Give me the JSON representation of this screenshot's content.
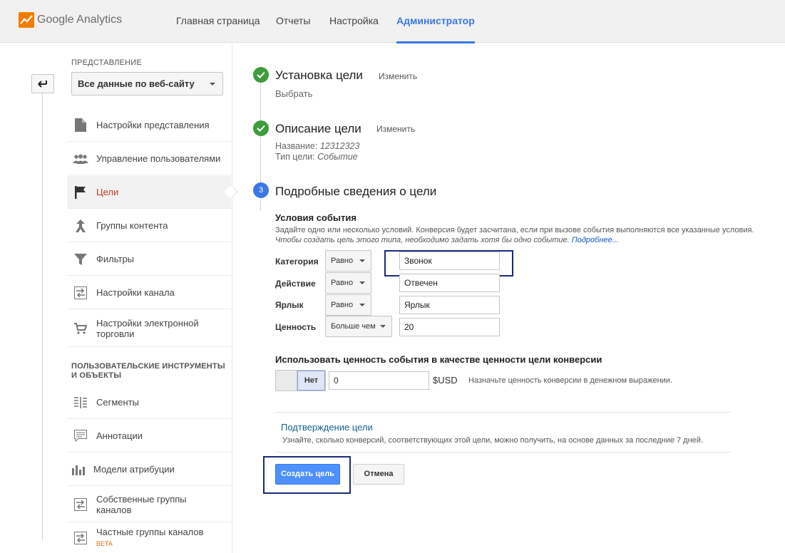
{
  "app": {
    "name": "Google Analytics",
    "accent": "#3b78e7"
  },
  "nav": {
    "items": [
      {
        "label": "Главная страница"
      },
      {
        "label": "Отчеты"
      },
      {
        "label": "Настройка"
      },
      {
        "label": "Администратор",
        "active": true
      }
    ]
  },
  "sidebar": {
    "section_view": "ПРЕДСТАВЛЕНИЕ",
    "view_select": "Все данные по веб-сайту",
    "items": [
      {
        "label": "Настройки представления",
        "icon": "document-icon"
      },
      {
        "label": "Управление пользователями",
        "icon": "users-icon"
      },
      {
        "label": "Цели",
        "icon": "flag-icon",
        "active": true
      },
      {
        "label": "Группы контента",
        "icon": "content-groups-icon"
      },
      {
        "label": "Фильтры",
        "icon": "filter-icon"
      },
      {
        "label": "Настройки канала",
        "icon": "channel-icon"
      },
      {
        "label": "Настройки электронной торговли",
        "icon": "cart-icon"
      }
    ],
    "section_custom": "ПОЛЬЗОВАТЕЛЬСКИЕ ИНСТРУМЕНТЫ И ОБЪЕКТЫ",
    "custom_items": [
      {
        "label": "Сегменты",
        "icon": "segments-icon"
      },
      {
        "label": "Аннотации",
        "icon": "annotations-icon"
      },
      {
        "label": "Модели атрибуции",
        "icon": "attribution-icon"
      },
      {
        "label": "Собственные группы каналов",
        "icon": "channel-groups-icon"
      },
      {
        "label": "Частные группы каналов",
        "badge": "BETA",
        "icon": "private-channel-groups-icon"
      }
    ]
  },
  "steps": {
    "setup": {
      "title": "Установка цели",
      "edit": "Изменить",
      "value": "Выбрать"
    },
    "description": {
      "title": "Описание цели",
      "edit": "Изменить",
      "name_label": "Название:",
      "name_value": "12312323",
      "type_label": "Тип цели:",
      "type_value": "Событие"
    },
    "details": {
      "number": "3",
      "title": "Подробные сведения о цели"
    }
  },
  "conditions": {
    "title": "Условия события",
    "desc_line1": "Задайте одно или несколько условий. Конверсия будет засчитана, если при вызове события выполняются все указанные условия.",
    "desc_line2": "Чтобы создать цель этого типа, необходимо задать хотя бы одно событие.",
    "desc_link": "Подробнее...",
    "rows": [
      {
        "label": "Категория",
        "operator": "Равно",
        "value": "Звонок"
      },
      {
        "label": "Действие",
        "operator": "Равно",
        "value": "Отвечен"
      },
      {
        "label": "Ярлык",
        "operator": "Равно",
        "value": "Ярлык"
      },
      {
        "label": "Ценность",
        "operator": "Больше чем",
        "value": "20"
      }
    ]
  },
  "use_value": {
    "title": "Использовать ценность события в качестве ценности цели конверсии",
    "toggle_label": "Нет",
    "amount": "0",
    "currency": "$USD",
    "hint": "Назначьте ценность конверсии в денежном выражении."
  },
  "verify": {
    "link": "Подтверждение цели",
    "hint": "Узнайте, сколько конверсий, соответствующих этой цели, можно получить, на основе данных за последние 7 дней."
  },
  "actions": {
    "create": "Создать цель",
    "cancel": "Отмена"
  }
}
